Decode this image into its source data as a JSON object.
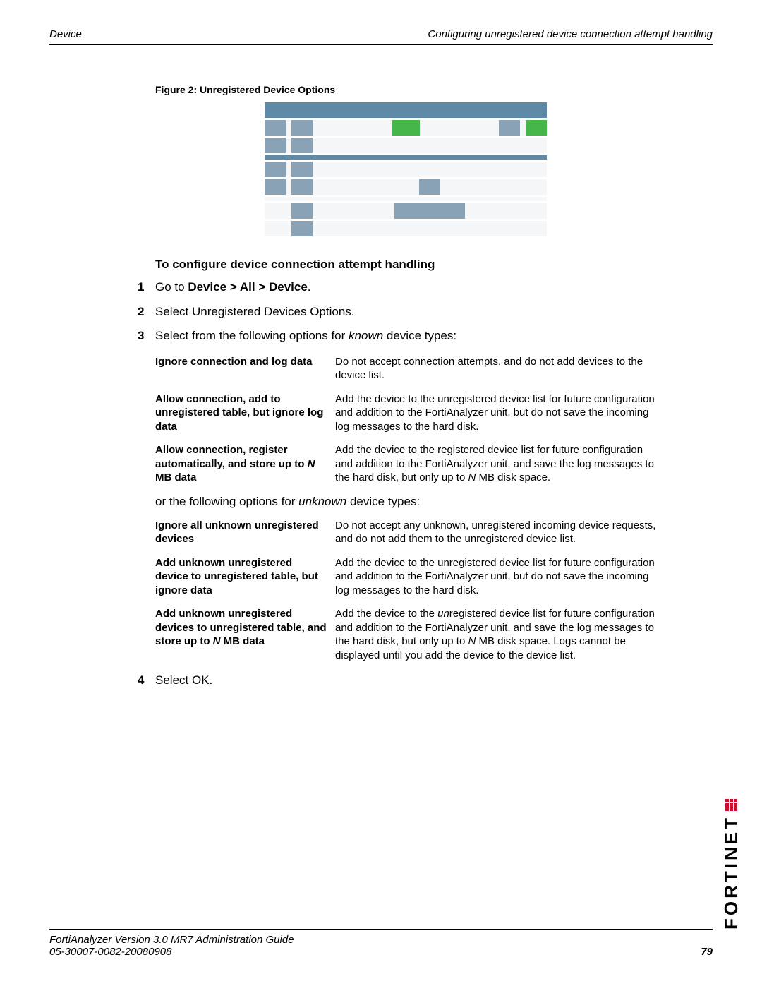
{
  "header": {
    "left": "Device",
    "right": "Configuring unregistered device connection attempt handling"
  },
  "figure": {
    "caption": "Figure 2:   Unregistered Device Options"
  },
  "section_title": "To configure device connection attempt handling",
  "steps": {
    "s1": {
      "num": "1",
      "pre": "Go to ",
      "bold": "Device > All > Device",
      "post": "."
    },
    "s2": {
      "num": "2",
      "text": "Select Unregistered Devices Options."
    },
    "s3": {
      "num": "3",
      "pre": "Select from the following options for ",
      "ital": "known",
      "post": " device types:"
    },
    "s4": {
      "num": "4",
      "text": "Select OK."
    }
  },
  "between_tables": {
    "pre": "or the following options for ",
    "ital": "unknown",
    "post": " device types:"
  },
  "known": {
    "r1": {
      "label": "Ignore connection and log data",
      "desc": "Do not accept connection attempts, and do not add devices to the device list."
    },
    "r2": {
      "label": "Allow connection, add to unregistered table, but ignore log data",
      "desc": "Add the device to the unregistered device list for future configuration and addition to the FortiAnalyzer unit, but do not save the incoming log messages to the hard disk."
    },
    "r3": {
      "label_a": "Allow connection, register automatically, and store up to ",
      "label_n": "N",
      "label_b": " MB data",
      "desc_a": "Add the device to the registered device list for future configuration and addition to the FortiAnalyzer unit, and save the log messages to the hard disk, but only up to ",
      "desc_n": "N",
      "desc_b": " MB disk space."
    }
  },
  "unknown": {
    "r1": {
      "label": "Ignore all unknown unregistered devices",
      "desc": "Do not accept any unknown, unregistered incoming device requests, and do not add them to the unregistered device list."
    },
    "r2": {
      "label": "Add unknown unregistered device to unregistered table, but ignore data",
      "desc": "Add the device to the unregistered device list for future configuration and addition to the FortiAnalyzer unit, but do not save the incoming log messages to the hard disk."
    },
    "r3": {
      "label_a": "Add unknown unregistered devices to unregistered table, and store up to ",
      "label_n": "N",
      "label_b": " MB data",
      "desc_a": "Add the device to the ",
      "desc_un": "un",
      "desc_b": "registered device list for future configuration and addition to the FortiAnalyzer unit, and save the log messages to the hard disk, but only up to ",
      "desc_n": "N",
      "desc_c": " MB disk space. Logs cannot be displayed until you add the device to the device list."
    }
  },
  "footer": {
    "title": "FortiAnalyzer Version 3.0 MR7 Administration Guide",
    "docnum": "05-30007-0082-20080908",
    "page": "79"
  },
  "logo": "FORTINET"
}
